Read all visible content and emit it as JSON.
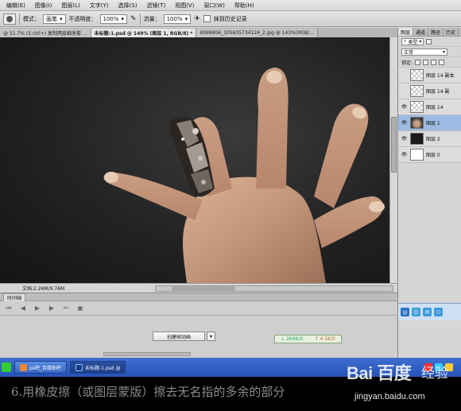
{
  "menu": [
    "编辑(E)",
    "图像(I)",
    "图层(L)",
    "文字(Y)",
    "选择(S)",
    "滤镜(T)",
    "视图(V)",
    "窗口(W)",
    "帮助(H)"
  ],
  "options": {
    "mode_label": "模式：",
    "mode_value": "画笔",
    "opacity_label": "不透明度：",
    "opacity_value": "100%",
    "flow_label": "流量：",
    "flow_value": "100%",
    "erase_history_label": "抹到历史记录"
  },
  "tabs": [
    "@ 51.7% (5.ctrl+) 复制两层细发套 ...",
    "未标题-1.psd @ 149% (图层 1, RGB/8) *",
    "6996806_105635734124_2.jpg @ 143%(RGB/..."
  ],
  "status": {
    "doc_info": "文档:2.26M/9.76M"
  },
  "timeline": {
    "title": "时间轴",
    "create_button": "创建帧动画",
    "net_down": "269K/S",
    "net_up": "4.5K/S"
  },
  "layers_panel": {
    "tabs": [
      "图层",
      "通道",
      "路径",
      "历史"
    ],
    "kind_filter": "类型",
    "blend_mode": "正常",
    "lock_label": "锁定:",
    "layers": [
      {
        "name": "图层 14 副本",
        "thumb": "trans",
        "visible": false,
        "selected": false
      },
      {
        "name": "图层 14 副",
        "thumb": "trans",
        "visible": false,
        "selected": false
      },
      {
        "name": "图层 14",
        "thumb": "trans",
        "visible": true,
        "selected": false
      },
      {
        "name": "图层 1",
        "thumb": "hand",
        "visible": true,
        "selected": true
      },
      {
        "name": "图层 2",
        "thumb": "dark",
        "visible": true,
        "selected": false
      },
      {
        "name": "图层 0",
        "thumb": "white",
        "visible": true,
        "selected": false
      }
    ]
  },
  "taskbar": {
    "items": [
      "ps吧_百度贴吧",
      "未标题-1.psd @"
    ]
  },
  "caption": "6.用橡皮擦（或图层蒙版）擦去无名指的多余的部分",
  "watermark": {
    "logo": "Bai 百度",
    "suffix": "经验",
    "url": "jingyan.baidu.com"
  },
  "colors": {
    "selection_blue": "#9dbbe3",
    "taskbar_blue": "#2552b8",
    "canvas_bg": "#222222"
  }
}
